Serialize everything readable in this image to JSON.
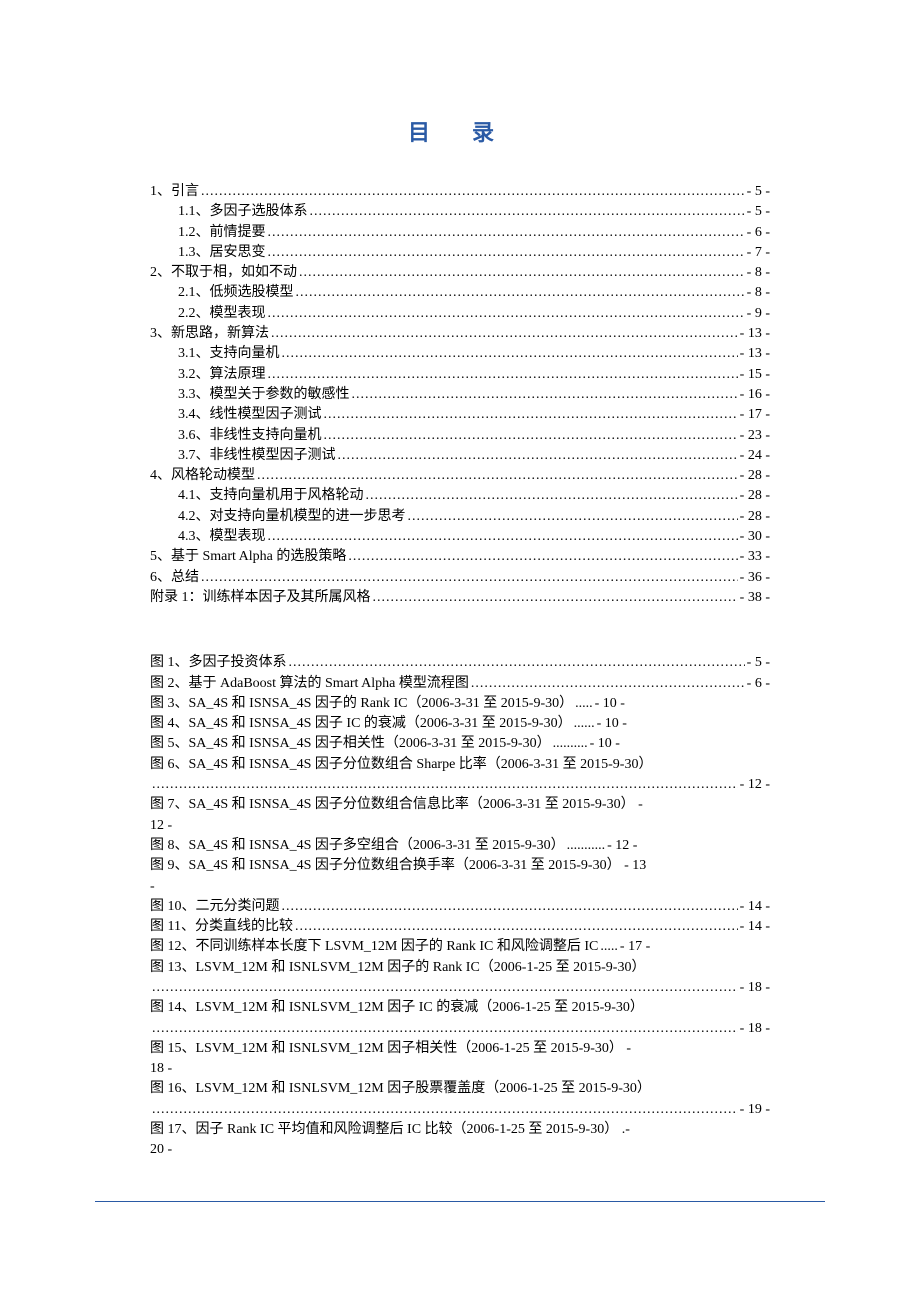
{
  "title": "目 录",
  "toc": [
    {
      "indent": 0,
      "label": "1、引言",
      "page": "- 5 -"
    },
    {
      "indent": 1,
      "label": "1.1、多因子选股体系",
      "page": "- 5 -"
    },
    {
      "indent": 1,
      "label": "1.2、前情提要",
      "page": "- 6 -"
    },
    {
      "indent": 1,
      "label": "1.3、居安思变",
      "page": "- 7 -"
    },
    {
      "indent": 0,
      "label": "2、不取于相，如如不动",
      "page": "- 8 -"
    },
    {
      "indent": 1,
      "label": "2.1、低频选股模型",
      "page": "- 8 -"
    },
    {
      "indent": 1,
      "label": "2.2、模型表现",
      "page": "- 9 -"
    },
    {
      "indent": 0,
      "label": "3、新思路，新算法",
      "page": "- 13 -"
    },
    {
      "indent": 1,
      "label": "3.1、支持向量机",
      "page": "- 13 -"
    },
    {
      "indent": 1,
      "label": "3.2、算法原理",
      "page": "- 15 -"
    },
    {
      "indent": 1,
      "label": "3.3、模型关于参数的敏感性",
      "page": "- 16 -"
    },
    {
      "indent": 1,
      "label": "3.4、线性模型因子测试",
      "page": "- 17 -"
    },
    {
      "indent": 1,
      "label": "3.6、非线性支持向量机",
      "page": "- 23 -"
    },
    {
      "indent": 1,
      "label": "3.7、非线性模型因子测试",
      "page": "- 24 -"
    },
    {
      "indent": 0,
      "label": "4、风格轮动模型",
      "page": "- 28 -"
    },
    {
      "indent": 1,
      "label": "4.1、支持向量机用于风格轮动",
      "page": "- 28 -"
    },
    {
      "indent": 1,
      "label": "4.2、对支持向量机模型的进一步思考",
      "page": "- 28 -"
    },
    {
      "indent": 1,
      "label": "4.3、模型表现",
      "page": "- 30 -"
    },
    {
      "indent": 0,
      "label": "5、基于 Smart Alpha 的选股策略",
      "page": "- 33 -"
    },
    {
      "indent": 0,
      "label": "6、总结",
      "page": "- 36 -"
    },
    {
      "indent": 0,
      "label": "附录 1：训练样本因子及其所属风格",
      "page": "- 38 -"
    }
  ],
  "figs": [
    {
      "type": "single",
      "label": "图 1、多因子投资体系",
      "page": "- 5 -"
    },
    {
      "type": "single",
      "label": "图 2、基于 AdaBoost 算法的 Smart Alpha 模型流程图",
      "page": "- 6 -"
    },
    {
      "type": "single",
      "label": "图 3、SA_4S 和 ISNSA_4S 因子的 Rank IC（2006-3-31 至 2015-9-30）",
      "page": "- 10 -",
      "dotcnt": 5
    },
    {
      "type": "single",
      "label": "图 4、SA_4S 和 ISNSA_4S 因子 IC 的衰减（2006-3-31 至 2015-9-30）",
      "page": "- 10 -",
      "dotcnt": 6
    },
    {
      "type": "single",
      "label": "图 5、SA_4S 和 ISNSA_4S 因子相关性（2006-3-31 至 2015-9-30）",
      "page": "- 10 -",
      "dotcnt": 10
    },
    {
      "type": "wrap",
      "line1": "图 6、SA_4S 和 ISNSA_4S 因子分位数组合 Sharpe 比率（2006-3-31 至 2015-9-30）",
      "line2_leader": true,
      "page": "- 12 -"
    },
    {
      "type": "wrap",
      "line1": "图 7、SA_4S 和 ISNSA_4S 因子分位数组合信息比率（2006-3-31 至 2015-9-30） - ",
      "line2": "12 -"
    },
    {
      "type": "single",
      "label": "图 8、SA_4S 和 ISNSA_4S 因子多空组合（2006-3-31 至 2015-9-30）",
      "page": "- 12 -",
      "dotcnt": 11
    },
    {
      "type": "wrap",
      "line1": "图 9、SA_4S 和 ISNSA_4S 因子分位数组合换手率（2006-3-31 至 2015-9-30） - 13",
      "line2": "-"
    },
    {
      "type": "single",
      "label": "图 10、二元分类问题",
      "page": "- 14 -"
    },
    {
      "type": "single",
      "label": "图 11、分类直线的比较",
      "page": "- 14 -"
    },
    {
      "type": "single",
      "label": "图 12、不同训练样本长度下 LSVM_12M 因子的 Rank IC 和风险调整后 IC",
      "page": "- 17 -",
      "dotcnt": 5
    },
    {
      "type": "wrap",
      "line1": "图 13、LSVM_12M 和 ISNLSVM_12M 因子的 Rank IC（2006-1-25 至 2015-9-30）",
      "line2_leader": true,
      "page": "- 18 -"
    },
    {
      "type": "wrap",
      "line1": "图 14、LSVM_12M 和 ISNLSVM_12M 因子 IC 的衰减（2006-1-25 至 2015-9-30）",
      "line2_leader": true,
      "page": "- 18 -"
    },
    {
      "type": "wrap",
      "line1": "图 15、LSVM_12M 和 ISNLSVM_12M 因子相关性（2006-1-25 至 2015-9-30） - ",
      "line2": "18 -"
    },
    {
      "type": "wrap",
      "line1": "图 16、LSVM_12M 和 ISNLSVM_12M 因子股票覆盖度（2006-1-25 至 2015-9-30）",
      "line2_leader": true,
      "page": "- 19 -"
    },
    {
      "type": "wrap",
      "line1": "图 17、因子 Rank IC 平均值和风险调整后 IC 比较（2006-1-25 至 2015-9-30） .- ",
      "line2": "20 -"
    }
  ]
}
